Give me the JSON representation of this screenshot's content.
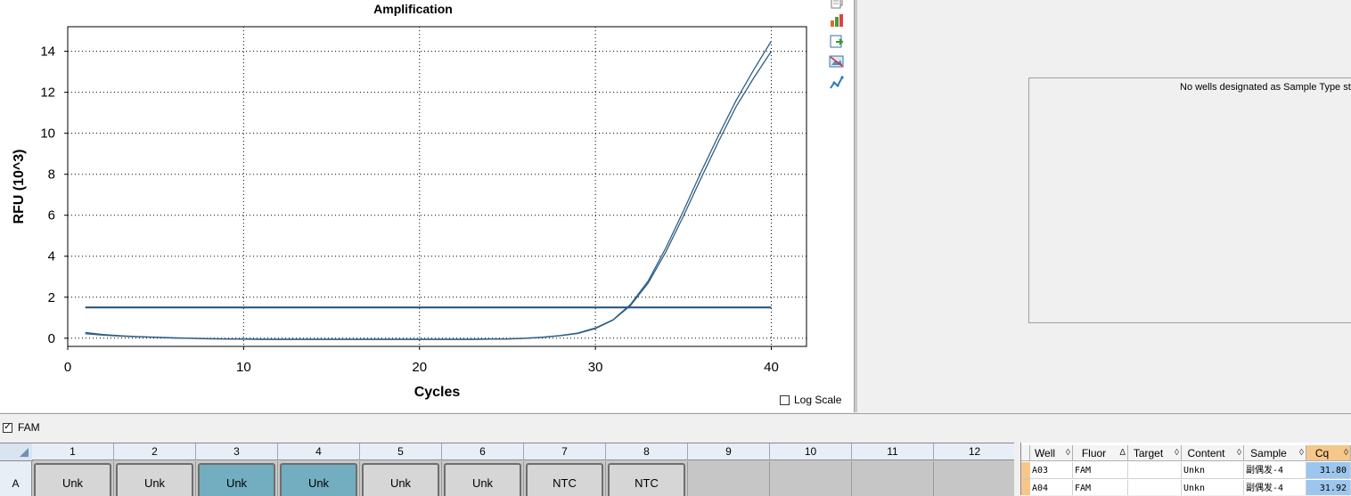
{
  "chart_data": {
    "type": "line",
    "title": "Amplification",
    "xlabel": "Cycles",
    "ylabel": "RFU (10^3)",
    "xlim": [
      0,
      42
    ],
    "ylim": [
      -0.4,
      15.2
    ],
    "xticks": [
      0,
      10,
      20,
      30,
      40
    ],
    "yticks": [
      0,
      2,
      4,
      6,
      8,
      10,
      12,
      14
    ],
    "grid": true,
    "threshold": 1.5,
    "series": [
      {
        "x": [
          1,
          2,
          3,
          4,
          5,
          6,
          7,
          8,
          9,
          10,
          11,
          12,
          13,
          14,
          15,
          16,
          17,
          18,
          19,
          20,
          21,
          22,
          23,
          24,
          25,
          26,
          27,
          28,
          29,
          30,
          31,
          32,
          33,
          34,
          35,
          36,
          37,
          38,
          39,
          40
        ],
        "values": [
          0.28,
          0.18,
          0.12,
          0.08,
          0.05,
          0.02,
          0.0,
          -0.02,
          -0.03,
          -0.04,
          -0.05,
          -0.05,
          -0.05,
          -0.05,
          -0.05,
          -0.05,
          -0.05,
          -0.05,
          -0.05,
          -0.05,
          -0.05,
          -0.05,
          -0.05,
          -0.04,
          -0.03,
          0.0,
          0.05,
          0.13,
          0.25,
          0.5,
          0.9,
          1.65,
          2.8,
          4.4,
          6.2,
          8.1,
          9.9,
          11.6,
          13.1,
          14.5
        ]
      },
      {
        "x": [
          1,
          2,
          3,
          4,
          5,
          6,
          7,
          8,
          9,
          10,
          11,
          12,
          13,
          14,
          15,
          16,
          17,
          18,
          19,
          20,
          21,
          22,
          23,
          24,
          25,
          26,
          27,
          28,
          29,
          30,
          31,
          32,
          33,
          34,
          35,
          36,
          37,
          38,
          39,
          40
        ],
        "values": [
          0.22,
          0.15,
          0.1,
          0.07,
          0.04,
          0.01,
          -0.01,
          -0.03,
          -0.04,
          -0.05,
          -0.06,
          -0.06,
          -0.06,
          -0.06,
          -0.06,
          -0.06,
          -0.06,
          -0.06,
          -0.06,
          -0.06,
          -0.06,
          -0.06,
          -0.06,
          -0.05,
          -0.04,
          -0.01,
          0.04,
          0.12,
          0.23,
          0.47,
          0.88,
          1.6,
          2.7,
          4.2,
          5.95,
          7.8,
          9.6,
          11.3,
          12.7,
          14.0
        ]
      }
    ]
  },
  "colors": {
    "series": "#2e5f86",
    "threshold": "#1f4e79",
    "well_selected": "#72aebf",
    "well_default": "#d6d6d6",
    "cq_highlight": "#9cc6ee"
  },
  "toolbar": {
    "icons": [
      "copy-icon",
      "chart-settings-icon",
      "export-icon",
      "image-icon",
      "graph-icon"
    ]
  },
  "log_scale": {
    "label": "Log Scale",
    "checked": false
  },
  "standard_curve": {
    "message": "No wells designated as Sample Type star"
  },
  "fluor_filter": {
    "label": "FAM",
    "checked": true
  },
  "plate": {
    "row": "A",
    "columns": [
      "1",
      "2",
      "3",
      "4",
      "5",
      "6",
      "7",
      "8",
      "9",
      "10",
      "11",
      "12"
    ],
    "wells": [
      {
        "label": "Unk",
        "selected": false
      },
      {
        "label": "Unk",
        "selected": false
      },
      {
        "label": "Unk",
        "selected": true
      },
      {
        "label": "Unk",
        "selected": true
      },
      {
        "label": "Unk",
        "selected": false
      },
      {
        "label": "Unk",
        "selected": false
      },
      {
        "label": "NTC",
        "selected": false
      },
      {
        "label": "NTC",
        "selected": false
      },
      {
        "label": "",
        "selected": false
      },
      {
        "label": "",
        "selected": false
      },
      {
        "label": "",
        "selected": false
      },
      {
        "label": "",
        "selected": false
      }
    ]
  },
  "table": {
    "headers": [
      {
        "label": "Well",
        "sort": "◊"
      },
      {
        "label": "Fluor",
        "sort": "Δ"
      },
      {
        "label": "Target",
        "sort": "◊"
      },
      {
        "label": "Content",
        "sort": "◊"
      },
      {
        "label": "Sample",
        "sort": "◊"
      },
      {
        "label": "Cq",
        "sort": "◊"
      }
    ],
    "rows": [
      {
        "well": "A03",
        "fluor": "FAM",
        "target": "",
        "content": "Unkn",
        "sample": "副偶发-4",
        "cq": "31.80"
      },
      {
        "well": "A04",
        "fluor": "FAM",
        "target": "",
        "content": "Unkn",
        "sample": "副偶发-4",
        "cq": "31.92"
      }
    ]
  }
}
